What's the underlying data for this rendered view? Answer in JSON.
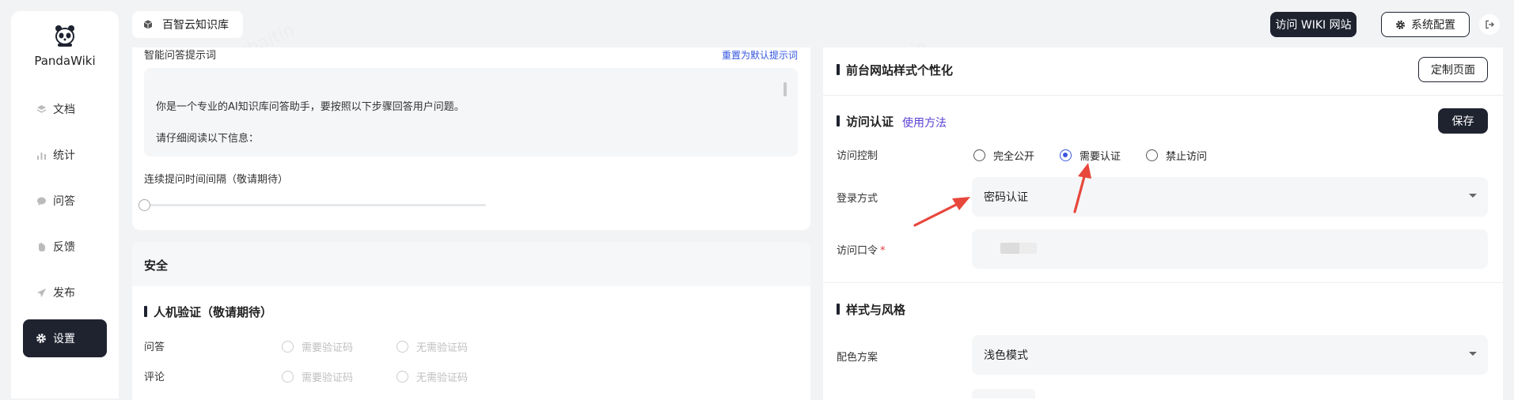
{
  "app": {
    "name": "PandaWiki",
    "knowledge_base": "百智云知识库"
  },
  "sidebar": {
    "items": [
      {
        "label": "文档",
        "icon": "layers-icon"
      },
      {
        "label": "统计",
        "icon": "bar-chart-icon"
      },
      {
        "label": "问答",
        "icon": "chat-bubble-icon"
      },
      {
        "label": "反馈",
        "icon": "hand-icon"
      },
      {
        "label": "发布",
        "icon": "send-icon"
      },
      {
        "label": "设置",
        "icon": "gear-icon",
        "active": true
      }
    ]
  },
  "header": {
    "visit_wiki": "访问 WIKI 网站",
    "system_config": "系统配置"
  },
  "left": {
    "prompt_title": "智能问答提示词",
    "reset_prompt": "重置为默认提示词",
    "prompt_lines": [
      "你是一个专业的AI知识库问答助手，要按照以下步骤回答用户问题。",
      "请仔细阅读以下信息："
    ],
    "interval_label": "连续提问时间间隔（敬请期待）",
    "interval_value": 0,
    "security_title": "安全",
    "captcha_title": "人机验证（敬请期待）",
    "captcha_rows": [
      {
        "label": "问答",
        "options": [
          "需要验证码",
          "无需验证码"
        ]
      },
      {
        "label": "评论",
        "options": [
          "需要验证码",
          "无需验证码"
        ]
      }
    ]
  },
  "right": {
    "style_title": "前台网站样式个性化",
    "custom_page": "定制页面",
    "auth_title": "访问认证",
    "usage_link": "使用方法",
    "save": "保存",
    "access_control_label": "访问控制",
    "access_options": [
      "完全公开",
      "需要认证",
      "禁止访问"
    ],
    "access_selected": "需要认证",
    "login_method_label": "登录方式",
    "login_method_value": "密码认证",
    "passcode_label": "访问口令",
    "passcode_required": "*",
    "theme_title": "样式与风格",
    "color_scheme_label": "配色方案",
    "color_scheme_value": "浅色模式"
  },
  "colors": {
    "accent": "#3a56e0",
    "dark": "#1f2330",
    "annotation_arrow": "#e8473b"
  }
}
